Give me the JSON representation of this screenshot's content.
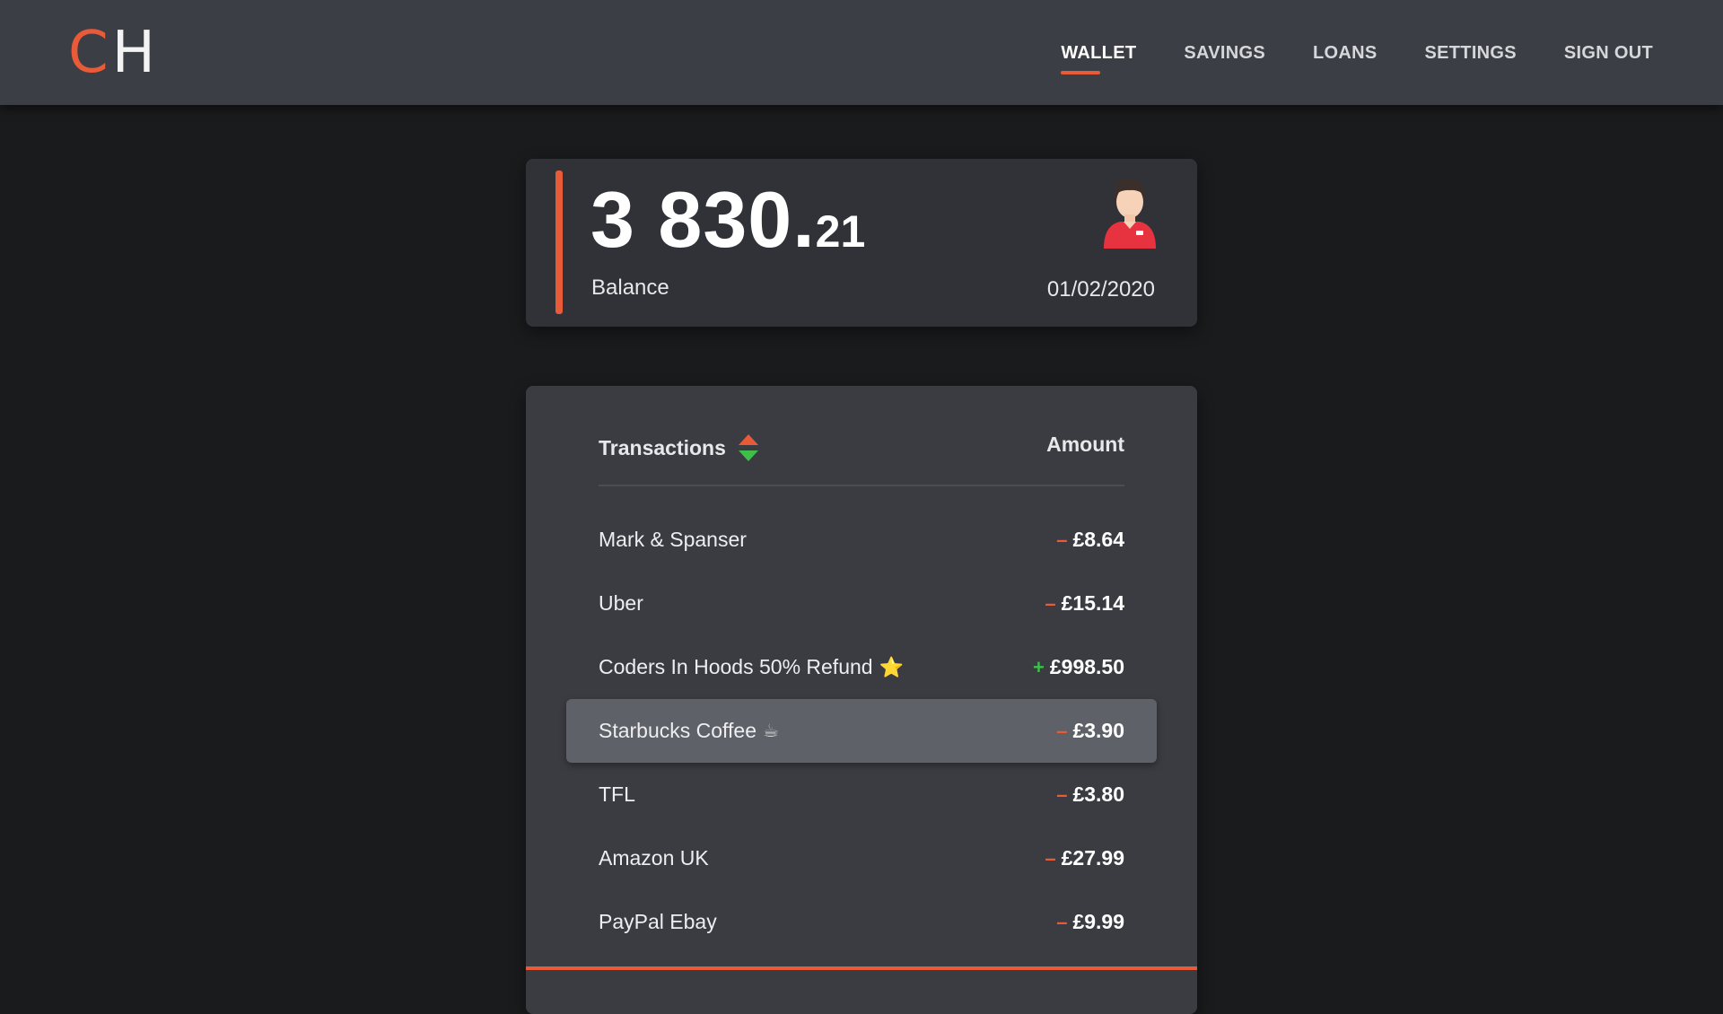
{
  "app": {
    "logo_left": "C",
    "logo_right": "H"
  },
  "nav": {
    "items": [
      {
        "label": "WALLET",
        "active": true
      },
      {
        "label": "SAVINGS",
        "active": false
      },
      {
        "label": "LOANS",
        "active": false
      },
      {
        "label": "SETTINGS",
        "active": false
      },
      {
        "label": "SIGN OUT",
        "active": false
      }
    ]
  },
  "balance": {
    "whole": "3 830.",
    "cents": "21",
    "label": "Balance",
    "date": "01/02/2020",
    "avatar_icon": "user-avatar-icon"
  },
  "transactions": {
    "title": "Transactions",
    "amount_header": "Amount",
    "sort_icon": "sort-up-down-icon",
    "selected_index": 3,
    "rows": [
      {
        "name": "Mark & Spanser",
        "emoji": "",
        "sign": "–",
        "direction": "out",
        "amount": "£8.64"
      },
      {
        "name": "Uber",
        "emoji": "",
        "sign": "–",
        "direction": "out",
        "amount": "£15.14"
      },
      {
        "name": "Coders In Hoods 50% Refund",
        "emoji": "⭐",
        "sign": "+",
        "direction": "in",
        "amount": "£998.50"
      },
      {
        "name": "Starbucks Coffee",
        "emoji": "☕",
        "sign": "–",
        "direction": "out",
        "amount": "£3.90"
      },
      {
        "name": "TFL",
        "emoji": "",
        "sign": "–",
        "direction": "out",
        "amount": "£3.80"
      },
      {
        "name": "Amazon UK",
        "emoji": "",
        "sign": "–",
        "direction": "out",
        "amount": "£27.99"
      },
      {
        "name": "PayPal Ebay",
        "emoji": "",
        "sign": "–",
        "direction": "out",
        "amount": "£9.99"
      }
    ]
  },
  "colors": {
    "accent": "#e95a38",
    "positive": "#3fbf4a",
    "header_bg": "#3b3e44",
    "page_bg": "#1a1b1d",
    "card_bg": "#3a3c42",
    "selected_row_bg": "#5f6169"
  }
}
